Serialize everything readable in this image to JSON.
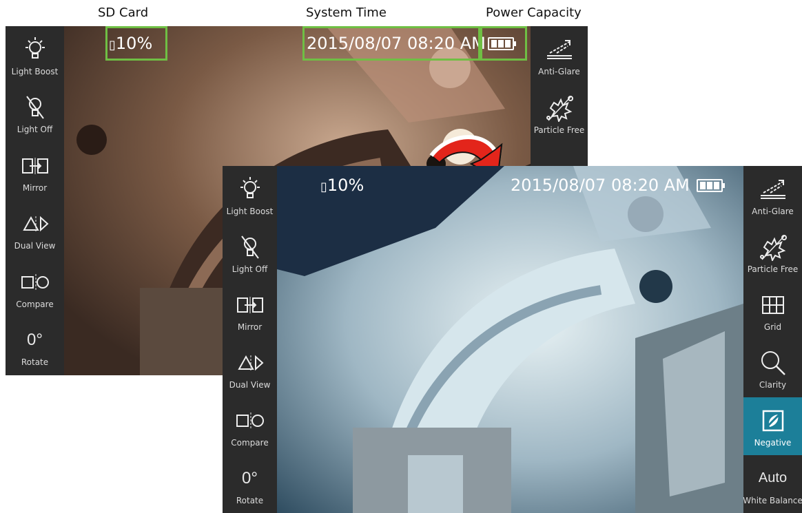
{
  "annotations": {
    "sd_card": "SD Card",
    "system_time": "System Time",
    "power_capacity": "Power Capacity"
  },
  "back_screen": {
    "sd_percent": "10%",
    "datetime": "2015/08/07  08:20 AM",
    "left_menu": [
      {
        "label": "Light Boost",
        "icon": "bulb-rays-icon"
      },
      {
        "label": "Light Off",
        "icon": "bulb-off-icon"
      },
      {
        "label": "Mirror",
        "icon": "mirror-icon"
      },
      {
        "label": "Dual View",
        "icon": "dual-view-icon"
      },
      {
        "label": "Compare",
        "icon": "compare-icon"
      },
      {
        "label": "Rotate",
        "icon": "rotate-value",
        "value": "0°"
      }
    ],
    "right_menu": [
      {
        "label": "Anti-Glare",
        "icon": "anti-glare-icon"
      },
      {
        "label": "Particle Free",
        "icon": "particle-free-icon"
      }
    ]
  },
  "front_screen": {
    "sd_percent": "10%",
    "datetime": "2015/08/07  08:20 AM",
    "left_menu": [
      {
        "label": "Light Boost",
        "icon": "bulb-rays-icon"
      },
      {
        "label": "Light Off",
        "icon": "bulb-off-icon"
      },
      {
        "label": "Mirror",
        "icon": "mirror-icon"
      },
      {
        "label": "Dual View",
        "icon": "dual-view-icon"
      },
      {
        "label": "Compare",
        "icon": "compare-icon"
      },
      {
        "label": "Rotate",
        "icon": "rotate-value",
        "value": "0°"
      }
    ],
    "right_menu": [
      {
        "label": "Anti-Glare",
        "icon": "anti-glare-icon"
      },
      {
        "label": "Particle Free",
        "icon": "particle-free-icon"
      },
      {
        "label": "Grid",
        "icon": "grid-icon"
      },
      {
        "label": "Clarity",
        "icon": "magnifier-icon"
      },
      {
        "label": "Negative",
        "icon": "negative-icon",
        "active": true
      },
      {
        "label": "White Balance",
        "icon": "white-balance-value",
        "value": "Auto"
      }
    ]
  },
  "colors": {
    "sidebar": "#2b2b2b",
    "active_item": "#1c7f99",
    "highlight_box": "#6fbf44",
    "arrow": "#e3251b"
  }
}
